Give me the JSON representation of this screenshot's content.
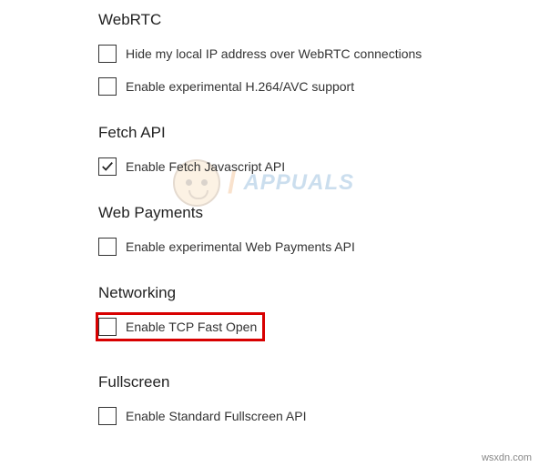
{
  "sections": {
    "webrtc": {
      "title": "WebRTC",
      "options": [
        {
          "label": "Hide my local IP address over WebRTC connections",
          "checked": false
        },
        {
          "label": "Enable experimental H.264/AVC support",
          "checked": false
        }
      ]
    },
    "fetch": {
      "title": "Fetch API",
      "options": [
        {
          "label": "Enable Fetch Javascript API",
          "checked": true
        }
      ]
    },
    "payments": {
      "title": "Web Payments",
      "options": [
        {
          "label": "Enable experimental Web Payments API",
          "checked": false
        }
      ]
    },
    "networking": {
      "title": "Networking",
      "options": [
        {
          "label": "Enable TCP Fast Open",
          "checked": false,
          "highlighted": true
        }
      ]
    },
    "fullscreen": {
      "title": "Fullscreen",
      "options": [
        {
          "label": "Enable Standard Fullscreen API",
          "checked": false
        }
      ]
    }
  },
  "watermark": {
    "text": "APPUALS"
  },
  "footer": "wsxdn.com"
}
